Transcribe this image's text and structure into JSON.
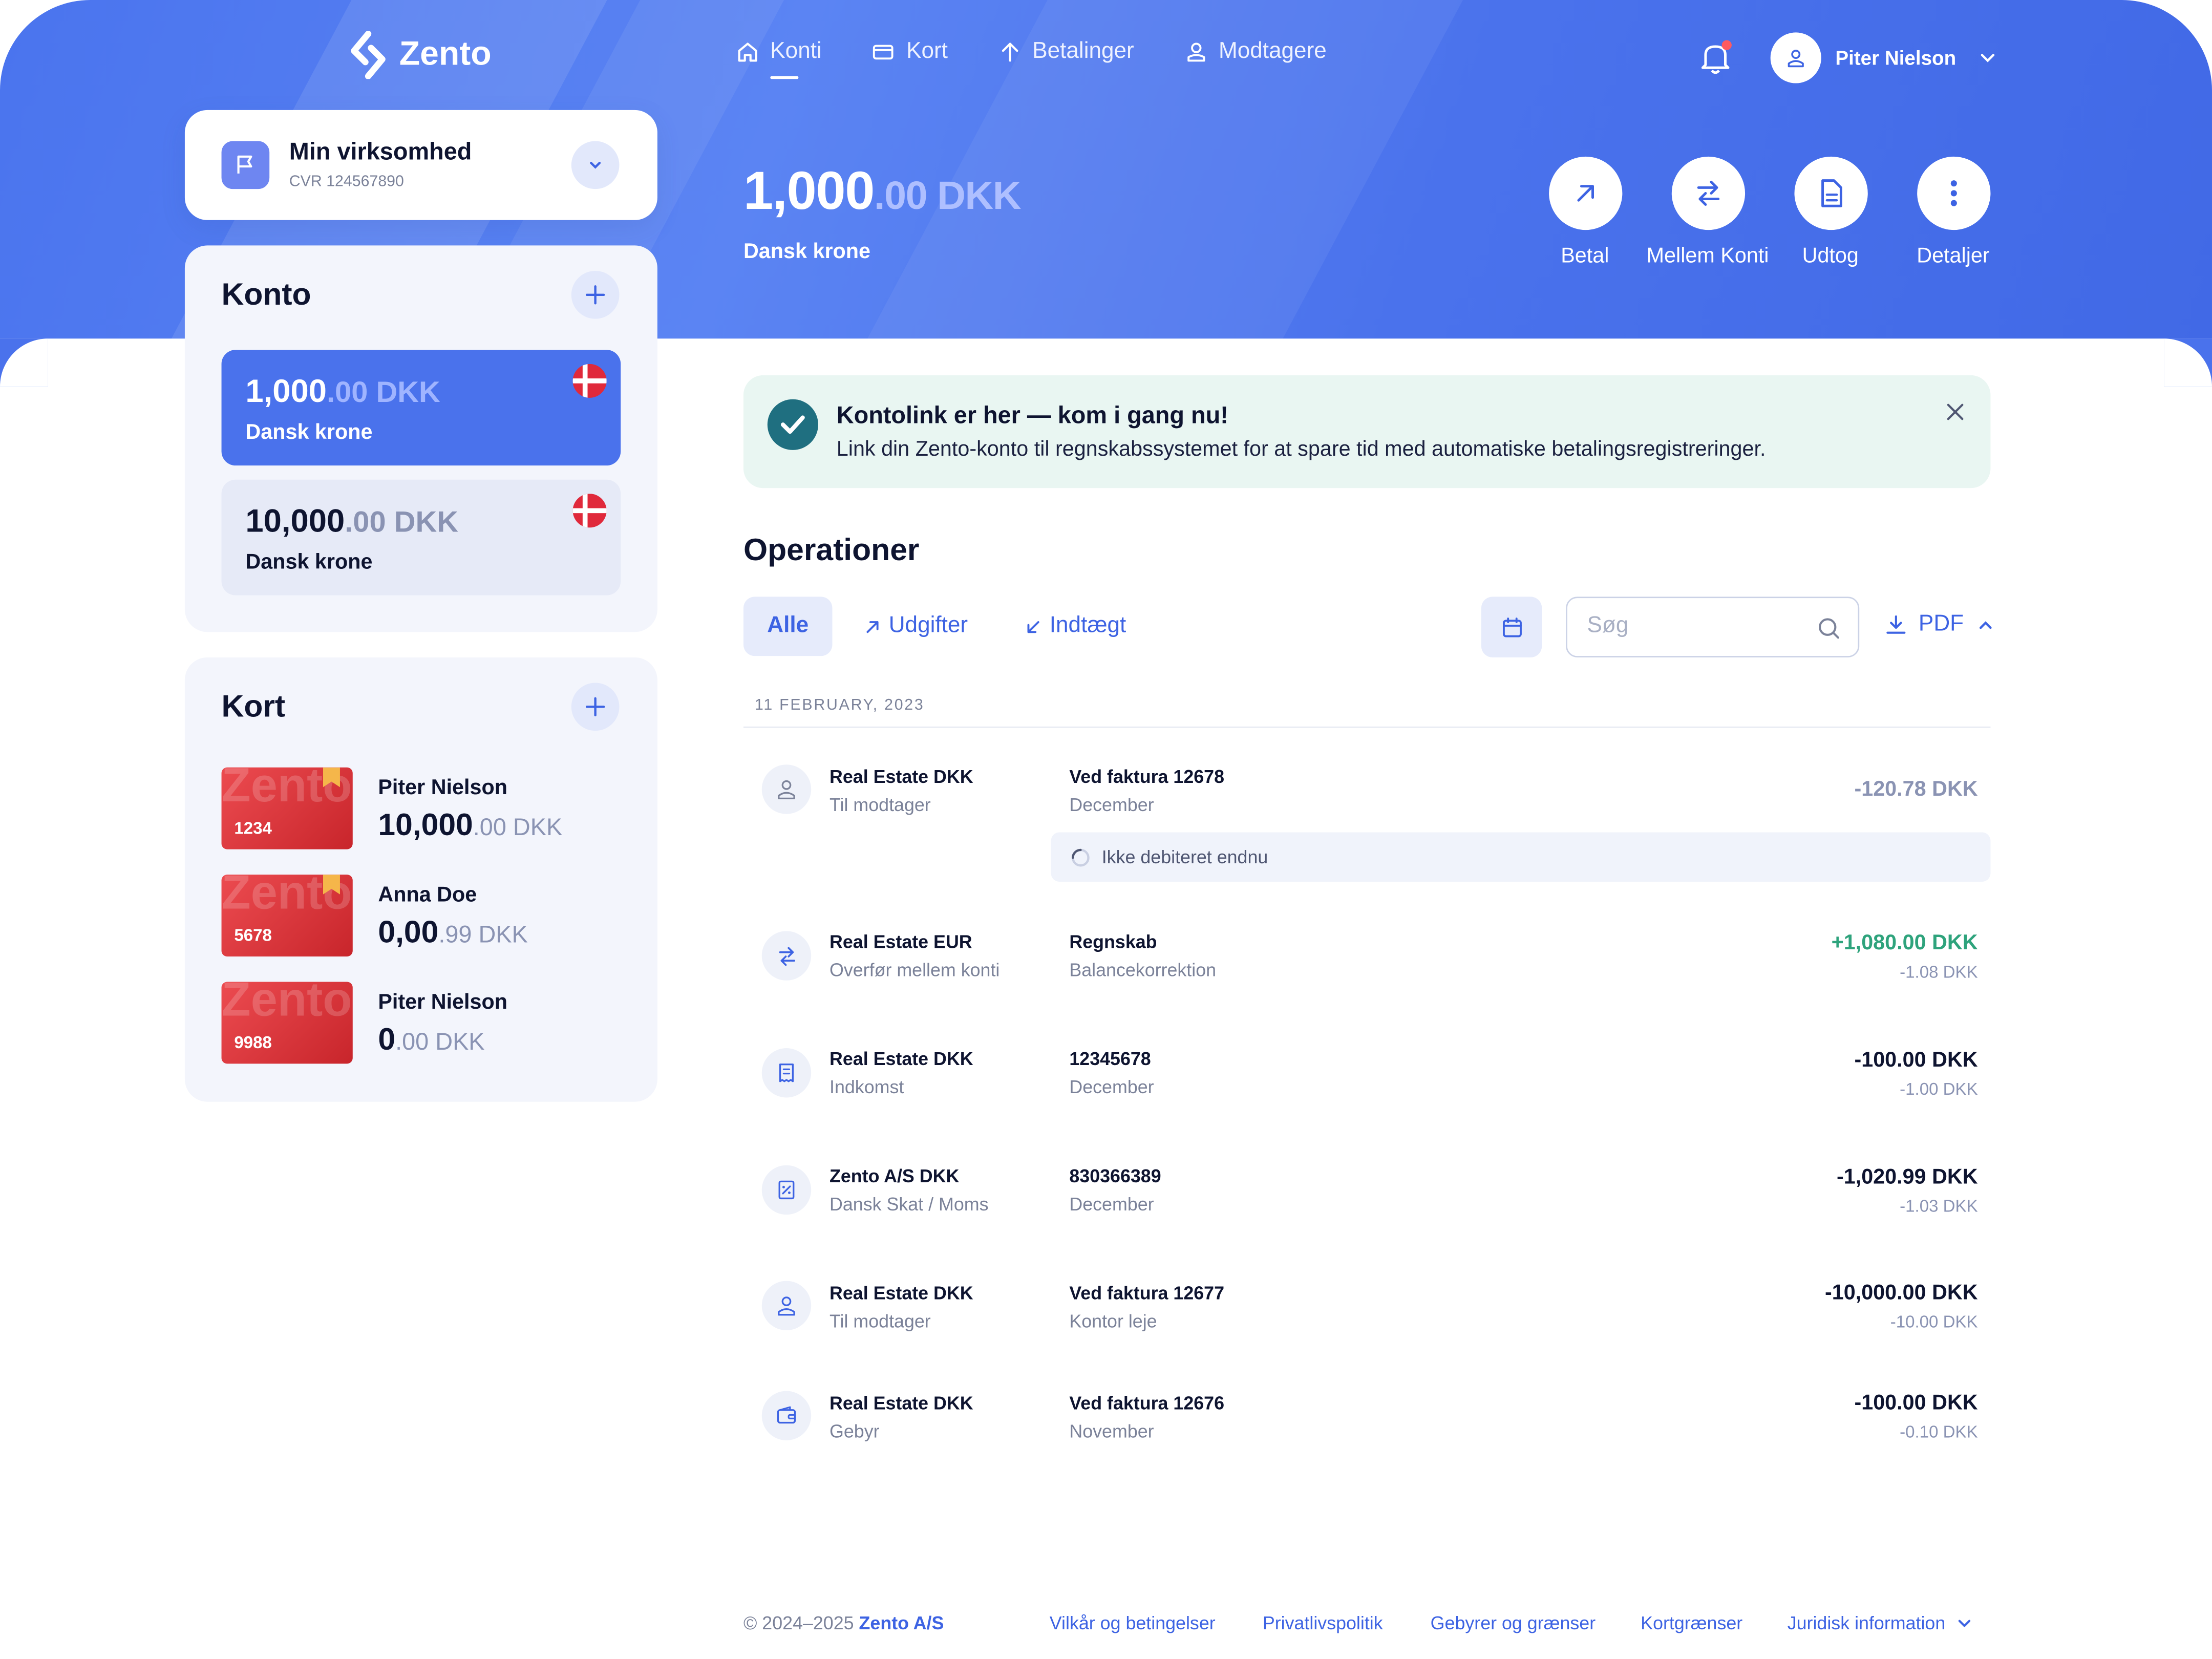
{
  "brand": {
    "name": "Zento"
  },
  "nav": [
    {
      "label": "Konti",
      "icon": "home-icon"
    },
    {
      "label": "Kort",
      "icon": "card-icon"
    },
    {
      "label": "Betalinger",
      "icon": "arrow-up-icon"
    },
    {
      "label": "Modtagere",
      "icon": "recipients-icon"
    }
  ],
  "user": {
    "name": "Piter Nielson"
  },
  "business": {
    "name": "Min virksomhed",
    "cvr": "CVR 124567890"
  },
  "balance": {
    "integer": "1,000",
    "decimal": ".00 DKK",
    "currency_name": "Dansk krone"
  },
  "actions": [
    {
      "label": "Betal",
      "icon": "arrow-up-right-icon"
    },
    {
      "label": "Mellem Konti",
      "icon": "swap-icon"
    },
    {
      "label": "Udtog",
      "icon": "document-icon"
    },
    {
      "label": "Detaljer",
      "icon": "more-vertical-icon"
    }
  ],
  "konto": {
    "title": "Konto",
    "accounts": [
      {
        "integer": "1,000",
        "decimal": ".00 DKK",
        "name": "Dansk krone"
      },
      {
        "integer": "10,000",
        "decimal": ".00 DKK",
        "name": "Dansk krone"
      }
    ]
  },
  "kort": {
    "title": "Kort",
    "cards": [
      {
        "number": "1234",
        "holder": "Piter Nielson",
        "integer": "10,000",
        "decimal": ".00 DKK"
      },
      {
        "number": "5678",
        "holder": "Anna Doe",
        "integer": "0,00",
        "decimal": ".99 DKK"
      },
      {
        "number": "9988",
        "holder": "Piter Nielson",
        "integer": "0",
        "decimal": ".00 DKK"
      }
    ],
    "watermark": "Zento"
  },
  "banner": {
    "title": "Kontolink er her — kom i gang nu!",
    "text": "Link din Zento-konto til regnskabssystemet for at spare tid med automatiske betalingsregistreringer."
  },
  "operations": {
    "title": "Operationer",
    "filters": [
      "Alle",
      "Udgifter",
      "Indtægt"
    ],
    "search_placeholder": "Søg",
    "pdf_label": "PDF",
    "date_header": "11 FEBRUARY, 2023",
    "transactions": [
      {
        "name": "Real Estate DKK",
        "sub": "Til modtager",
        "ref": "Ved faktura 12678",
        "refsub": "December",
        "amount": "-120.78 DKK",
        "fee": "",
        "pending": "Ikke debiteret endnu",
        "icon": "user-icon"
      },
      {
        "name": "Real Estate EUR",
        "sub": "Overfør mellem konti",
        "ref": "Regnskab",
        "refsub": "Balancekorrektion",
        "amount": "+1,080.00 DKK",
        "fee": "-1.08 DKK",
        "icon": "swap-icon"
      },
      {
        "name": "Real Estate DKK",
        "sub": "Indkomst",
        "ref": "12345678",
        "refsub": "December",
        "amount": "-100.00 DKK",
        "fee": "-1.00 DKK",
        "icon": "receipt-icon"
      },
      {
        "name": "Zento A/S DKK",
        "sub": "Dansk Skat / Moms",
        "ref": "830366389",
        "refsub": "December",
        "amount": "-1,020.99 DKK",
        "fee": "-1.03 DKK",
        "icon": "tax-icon"
      },
      {
        "name": "Real Estate DKK",
        "sub": "Til modtager",
        "ref": "Ved faktura  12677",
        "refsub": "Kontor leje",
        "amount": "-10,000.00 DKK",
        "fee": "-10.00 DKK",
        "icon": "user-icon"
      },
      {
        "name": "Real Estate DKK",
        "sub": "Gebyr",
        "ref": "Ved faktura  12676",
        "refsub": "November",
        "amount": "-100.00 DKK",
        "fee": "-0.10 DKK",
        "icon": "wallet-icon"
      }
    ]
  },
  "footer": {
    "copyright": "© 2024–2025",
    "company": "Zento A/S",
    "links": [
      "Vilkår og betingelser",
      "Privatlivspolitik",
      "Gebyrer og grænser",
      "Kortgrænser",
      "Juridisk information"
    ]
  },
  "colors": {
    "primary": "#4a72ec",
    "accent_text": "#3d63e3",
    "positive": "#2ea37c",
    "card_red": "#d8343a",
    "banner_bg": "#e9f6f2"
  }
}
